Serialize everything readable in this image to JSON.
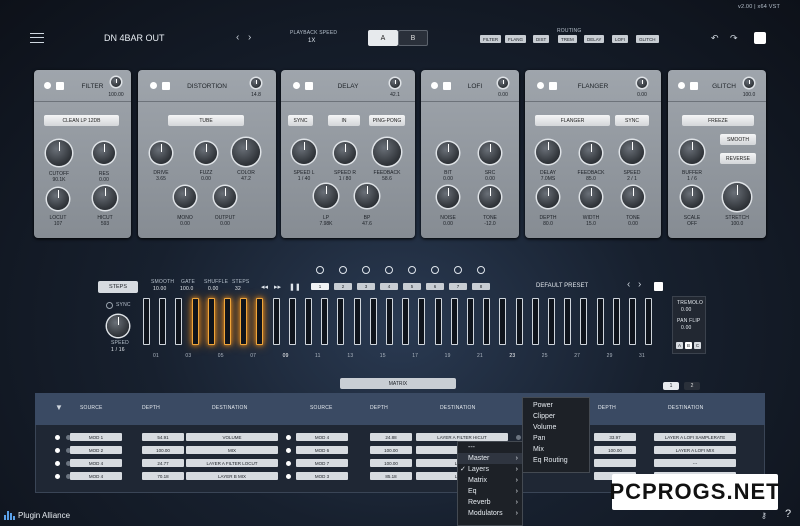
{
  "header": {
    "version": "v2.00  |  x64  VST",
    "preset": "DN 4BAR OUT",
    "playback_label": "PLAYBACK SPEED",
    "playback_value": "1X",
    "a": "A",
    "b": "B",
    "routing_label": "ROUTING",
    "routing": [
      "FILTER",
      "FLANG",
      "DIST",
      "TREM",
      "DELAY",
      "LOFI",
      "GLITCH"
    ]
  },
  "modules": {
    "filter": {
      "title": "FILTER",
      "value": "100.00",
      "select": "CLEAN LP 12DB",
      "k1": "CUTOFF",
      "v1": "90.1K",
      "k2": "RES",
      "v2": "0.00",
      "k3": "LOCUT",
      "v3": "107",
      "k4": "HICUT",
      "v4": "593"
    },
    "distortion": {
      "title": "DISTORTION",
      "value": "14.8",
      "select": "TUBE",
      "k1": "DRIVE",
      "v1": "3.65",
      "k2": "FUZZ",
      "v2": "0.00",
      "k3": "COLOR",
      "v3": "47.2",
      "k4": "MONO",
      "v4": "0.00",
      "k5": "OUTPUT",
      "v5": "0.00"
    },
    "delay": {
      "title": "DELAY",
      "value": "42.1",
      "b1": "SYNC",
      "b2": "IN",
      "b3": "PING-PONG",
      "k1": "SPEED L",
      "v1": "1 / 40",
      "k2": "SPEED R",
      "v2": "1 / 80",
      "k3": "FEEDBACK",
      "v3": "58.6",
      "k4": "LP",
      "v4": "7.98K",
      "k5": "BP",
      "v5": "47.6"
    },
    "lofi": {
      "title": "LOFI",
      "value": "0.00",
      "k1": "BIT",
      "v1": "0.00",
      "k2": "SRC",
      "v2": "0.00",
      "k3": "NOISE",
      "v3": "0.00",
      "k4": "TONE",
      "v4": "-12.0"
    },
    "flanger": {
      "title": "FLANGER",
      "value": "0.00",
      "b1": "FLANGER",
      "b2": "SYNC",
      "k1": "DELAY",
      "v1": "7.0MS",
      "k2": "FEEDBACK",
      "v2": "85.0",
      "k3": "SPEED",
      "v3": "2 / 1",
      "k4": "DEPTH",
      "v4": "80.0",
      "k5": "WIDTH",
      "v5": "15.0",
      "k6": "TONE",
      "v6": "0.00"
    },
    "glitch": {
      "title": "GLITCH",
      "value": "100.0",
      "b1": "FREEZE",
      "b2": "SMOOTH",
      "b3": "REVERSE",
      "k1": "BUFFER",
      "v1": "1 / 6",
      "k2": "SCALE",
      "v2": "OFF",
      "k3": "STRETCH",
      "v3": "100.0"
    }
  },
  "seq": {
    "steps": "STEPS",
    "smooth_l": "SMOOTH",
    "smooth_v": "10.00",
    "gate_l": "GATE",
    "gate_v": "100.0",
    "shuffle_l": "SHUFFLE",
    "shuffle_v": "0.00",
    "steps_l": "STEPS",
    "steps_v": "32",
    "sync": "SYNC",
    "speed_l": "SPEED",
    "speed_v": "1 / 16",
    "preset": "DEFAULT PRESET",
    "tremolo_l": "TREMOLO",
    "tremolo_v": "0.00",
    "pan_l": "PAN FLIP",
    "pan_v": "0.00",
    "pages": [
      "1",
      "2",
      "3",
      "4",
      "5",
      "6",
      "7",
      "8"
    ],
    "ticks": [
      "01",
      "03",
      "05",
      "07",
      "09",
      "11",
      "13",
      "15",
      "17",
      "19",
      "21",
      "23",
      "25",
      "27",
      "29",
      "31"
    ],
    "ab": [
      "A",
      "B",
      "C"
    ]
  },
  "matrix": {
    "title": "MATRIX",
    "page1": "1",
    "page2": "2",
    "headers": [
      "SOURCE",
      "DEPTH",
      "DESTINATION",
      "SOURCE",
      "DEPTH",
      "DESTINATION",
      "DEPTH",
      "DESTINATION"
    ],
    "rows": [
      {
        "src": "MOD 1",
        "depth": "54.91",
        "dest": "VOLUME",
        "src2": "MOD 4",
        "depth2": "24.88",
        "dest2": "LAYER A FILTER HICUT",
        "depth3": "33.97",
        "dest3": "LAYER A LOFI SAMPLERATE"
      },
      {
        "src": "MOD 2",
        "depth": "100.00",
        "dest": "MIX",
        "src2": "MOD 6",
        "depth2": "100.00",
        "dest2": "---",
        "depth3": "100.00",
        "dest3": "LAYER A LOFI MIX"
      },
      {
        "src": "MOD 4",
        "depth": "24.77",
        "dest": "LAYER A FILTER LOCUT",
        "src2": "MOD 7",
        "depth2": "100.00",
        "dest2": "LAYER",
        "depth3": "",
        "dest3": "---"
      },
      {
        "src": "MOD 4",
        "depth": "70.18",
        "dest": "LAYER B MIX",
        "src2": "MOD 3",
        "depth2": "85.18",
        "dest2": "LAYER",
        "depth3": "",
        "dest3": ""
      }
    ]
  },
  "menu": {
    "items": [
      "---",
      "Master",
      "Layers",
      "Matrix",
      "Eq",
      "Reverb",
      "Modulators"
    ],
    "sub": [
      "Power",
      "Clipper",
      "Volume",
      "Pan",
      "Mix",
      "Eq Routing"
    ]
  },
  "footer": {
    "brand": "Plugin Alliance",
    "watermark": "PCPROGS.NET",
    "help": "?"
  }
}
